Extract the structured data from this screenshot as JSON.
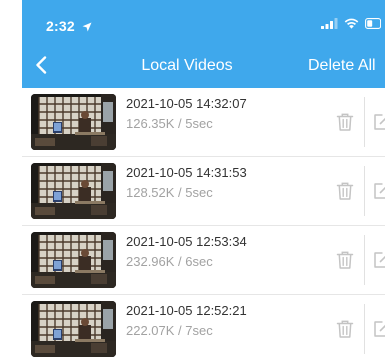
{
  "status_bar": {
    "time": "2:32"
  },
  "nav": {
    "title": "Local Videos",
    "delete_all_label": "Delete All"
  },
  "videos": [
    {
      "date": "2021-10-05 14:32:07",
      "meta": "126.35K / 5sec"
    },
    {
      "date": "2021-10-05 14:31:53",
      "meta": "128.52K / 5sec"
    },
    {
      "date": "2021-10-05 12:53:34",
      "meta": "232.96K / 6sec"
    },
    {
      "date": "2021-10-05 12:52:21",
      "meta": "222.07K / 7sec"
    }
  ],
  "colors": {
    "header": "#3fa8ec",
    "title_text": "#333333",
    "meta_text": "#a2a2a2",
    "icon": "#c4c4c4"
  }
}
